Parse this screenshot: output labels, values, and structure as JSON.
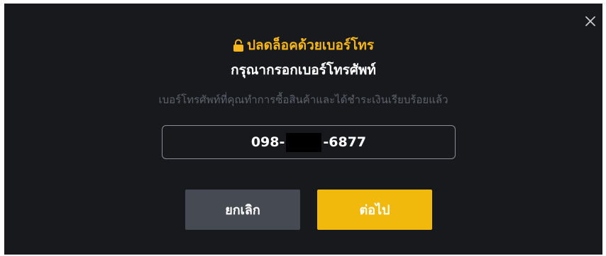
{
  "dialog": {
    "title": "ปลดล็อคด้วยเบอร์โทร",
    "subtitle": "กรุณากรอกเบอร์โทรศัพท์",
    "hint": "เบอร์โทรศัพท์ที่คุณทำการซื้อสินค้าและได้ชำระเงินเรียบร้อยแล้ว",
    "close_icon": "close-icon",
    "lock_icon": "lock-icon"
  },
  "phone": {
    "prefix": "098-",
    "suffix": "-6877"
  },
  "buttons": {
    "cancel_label": "ยกเลิก",
    "next_label": "ต่อไป"
  },
  "colors": {
    "background": "#18191c",
    "accent": "#f0b90b",
    "cancel_button": "#464a53",
    "hint_text": "#5f636b"
  }
}
